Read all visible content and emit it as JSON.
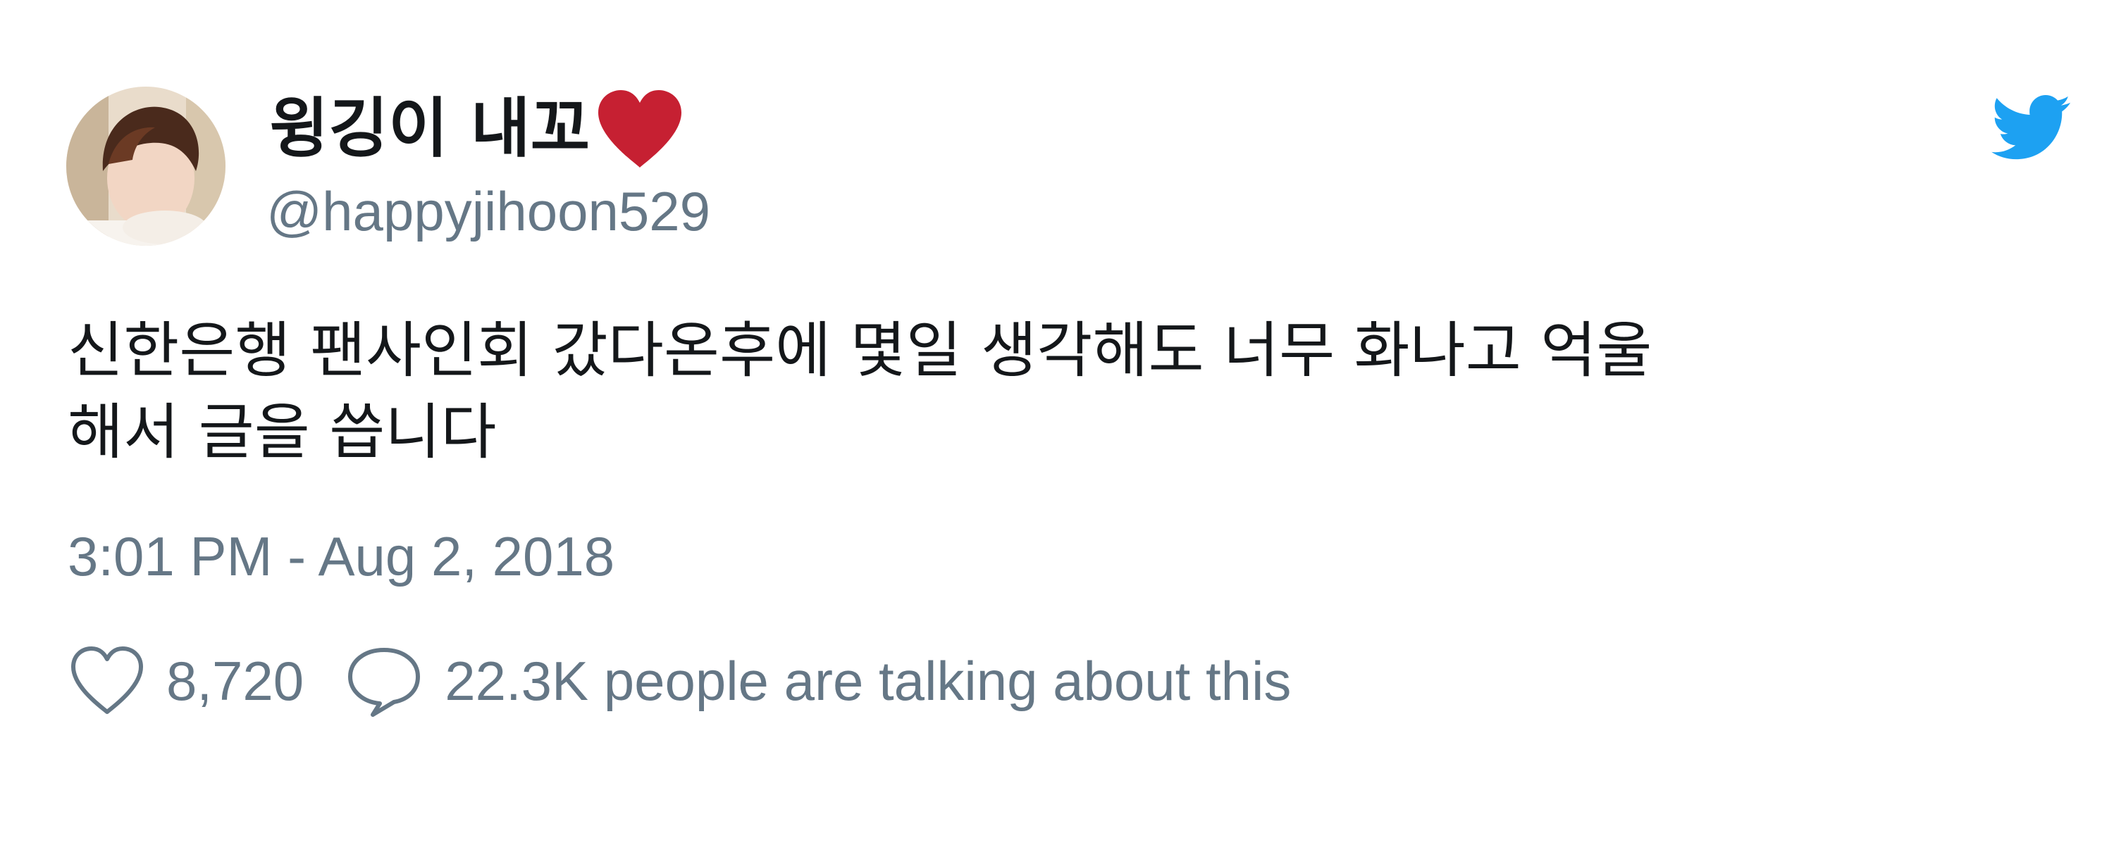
{
  "tweet": {
    "author": {
      "display_name": "윙깅이 내꼬",
      "name_emoji": "red-heart-emoji",
      "handle": "@happyjihoon529",
      "avatar": "profile-photo"
    },
    "brand_icon": "twitter-bird-icon",
    "text": "신한은행 팬사인회 갔다온후에 몇일 생각해도 너무 화나고 억울\n해서 글을 씁니다",
    "timestamp": "3:01 PM - Aug 2, 2018",
    "likes": {
      "icon": "heart-outline-icon",
      "count": "8,720"
    },
    "conversation": {
      "icon": "speech-bubble-icon",
      "text": "22.3K people are talking about this"
    }
  },
  "colors": {
    "text_primary": "#14171a",
    "text_secondary": "#657786",
    "twitter_blue": "#1da1f2",
    "heart_red": "#c62032",
    "background": "#ffffff"
  }
}
